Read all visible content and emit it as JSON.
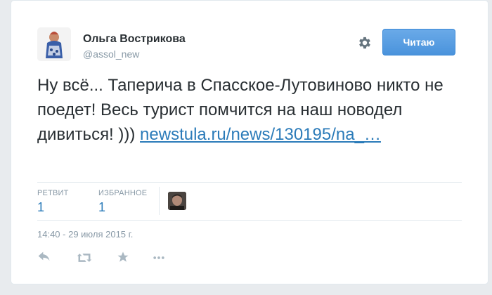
{
  "author": {
    "name": "Ольга Вострикова",
    "handle": "@assol_new"
  },
  "follow_button": {
    "label": "Читаю"
  },
  "tweet": {
    "text": "Ну всё... Таперича в Спасское-Лутовиново никто не поедет! Весь турист помчится на наш новодел дивиться! )))",
    "link": "newstula.ru/news/130195/na_…"
  },
  "stats": {
    "retweets_label": "РЕТВИТ",
    "retweets_count": "1",
    "favorites_label": "ИЗБРАННОЕ",
    "favorites_count": "1"
  },
  "timestamp": "14:40 - 29 июля 2015 г.",
  "icons": {
    "settings": "gear-icon",
    "reply": "reply-icon",
    "retweet": "retweet-icon",
    "favorite": "star-icon",
    "more": "more-icon"
  },
  "colors": {
    "accent": "#2b7bb9",
    "button": "#4a93dc",
    "muted": "#8899a6"
  }
}
